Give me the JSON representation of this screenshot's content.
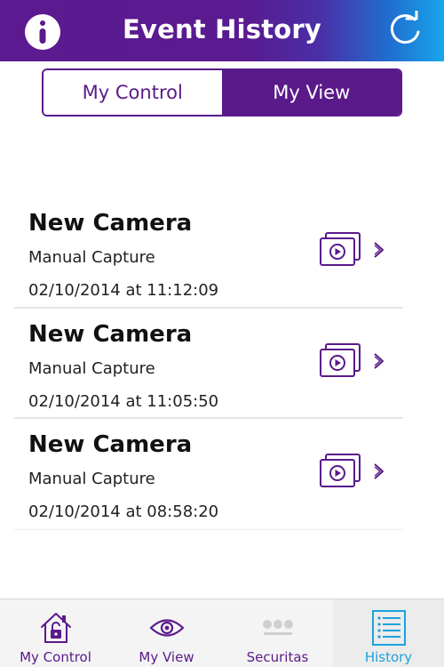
{
  "header": {
    "title": "Event History",
    "info_icon": "info-icon",
    "refresh_icon": "refresh-icon"
  },
  "segments": {
    "my_control": "My Control",
    "my_view": "My View",
    "selected": "My View"
  },
  "events": [
    {
      "title": "New Camera",
      "type": "Manual Capture",
      "datetime": "02/10/2014 at  11:12:09"
    },
    {
      "title": "New Camera",
      "type": "Manual Capture",
      "datetime": "02/10/2014 at  11:05:50"
    },
    {
      "title": "New Camera",
      "type": "Manual Capture",
      "datetime": "02/10/2014 at  08:58:20"
    }
  ],
  "tabbar": {
    "tabs": [
      {
        "label": "My Control",
        "icon": "house-lock-icon"
      },
      {
        "label": "My View",
        "icon": "eye-icon"
      },
      {
        "label": "Securitas",
        "icon": "securitas-logo-icon"
      },
      {
        "label": "History",
        "icon": "list-icon",
        "active": true
      }
    ]
  },
  "colors": {
    "brand_purple": "#5a1a8a",
    "accent_blue": "#1aa3dd"
  }
}
